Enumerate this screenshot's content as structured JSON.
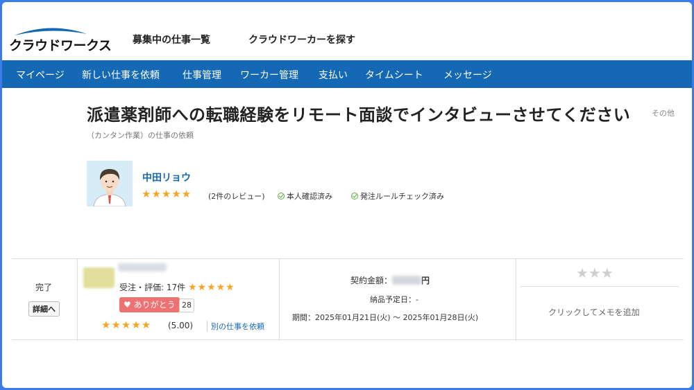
{
  "brand": {
    "logo_text": "クラウドワークス",
    "accent": "#1468b4",
    "frame_color": "#3c7ce6"
  },
  "top_links": [
    "募集中の仕事一覧",
    "クラウドワーカーを探す"
  ],
  "nav": [
    "マイページ",
    "新しい仕事を依頼",
    "仕事管理",
    "ワーカー管理",
    "支払い",
    "タイムシート",
    "メッセージ"
  ],
  "job": {
    "title": "派遣薬剤師への転職経験をリモート面談でインタビューさせてください",
    "category": "その他",
    "subtitle": "（カンタン作業）の仕事の依頼"
  },
  "client": {
    "name": "中田リョウ",
    "rating": 5,
    "reviews": "(2件のレビュー)",
    "badges": [
      "本人確認済み",
      "発注ルールチェック済み"
    ]
  },
  "order": {
    "status": "完了",
    "detail_button": "詳細へ",
    "worker": {
      "stats": "受注・評価: 17件",
      "rating": 5,
      "thanks_label": "ありがとう",
      "thanks_count": "28",
      "score": "(5.00)",
      "rehire_link": "別の仕事を依頼"
    },
    "contract": {
      "amount_label": "契約金額：",
      "amount_suffix": "円",
      "delivery": "納品予定日：-",
      "period": "期間：2025年01月21日(火) 〜 2025年01月28日(火)"
    },
    "memo": {
      "rating": 0,
      "add_label": "クリックしてメモを追加"
    }
  }
}
